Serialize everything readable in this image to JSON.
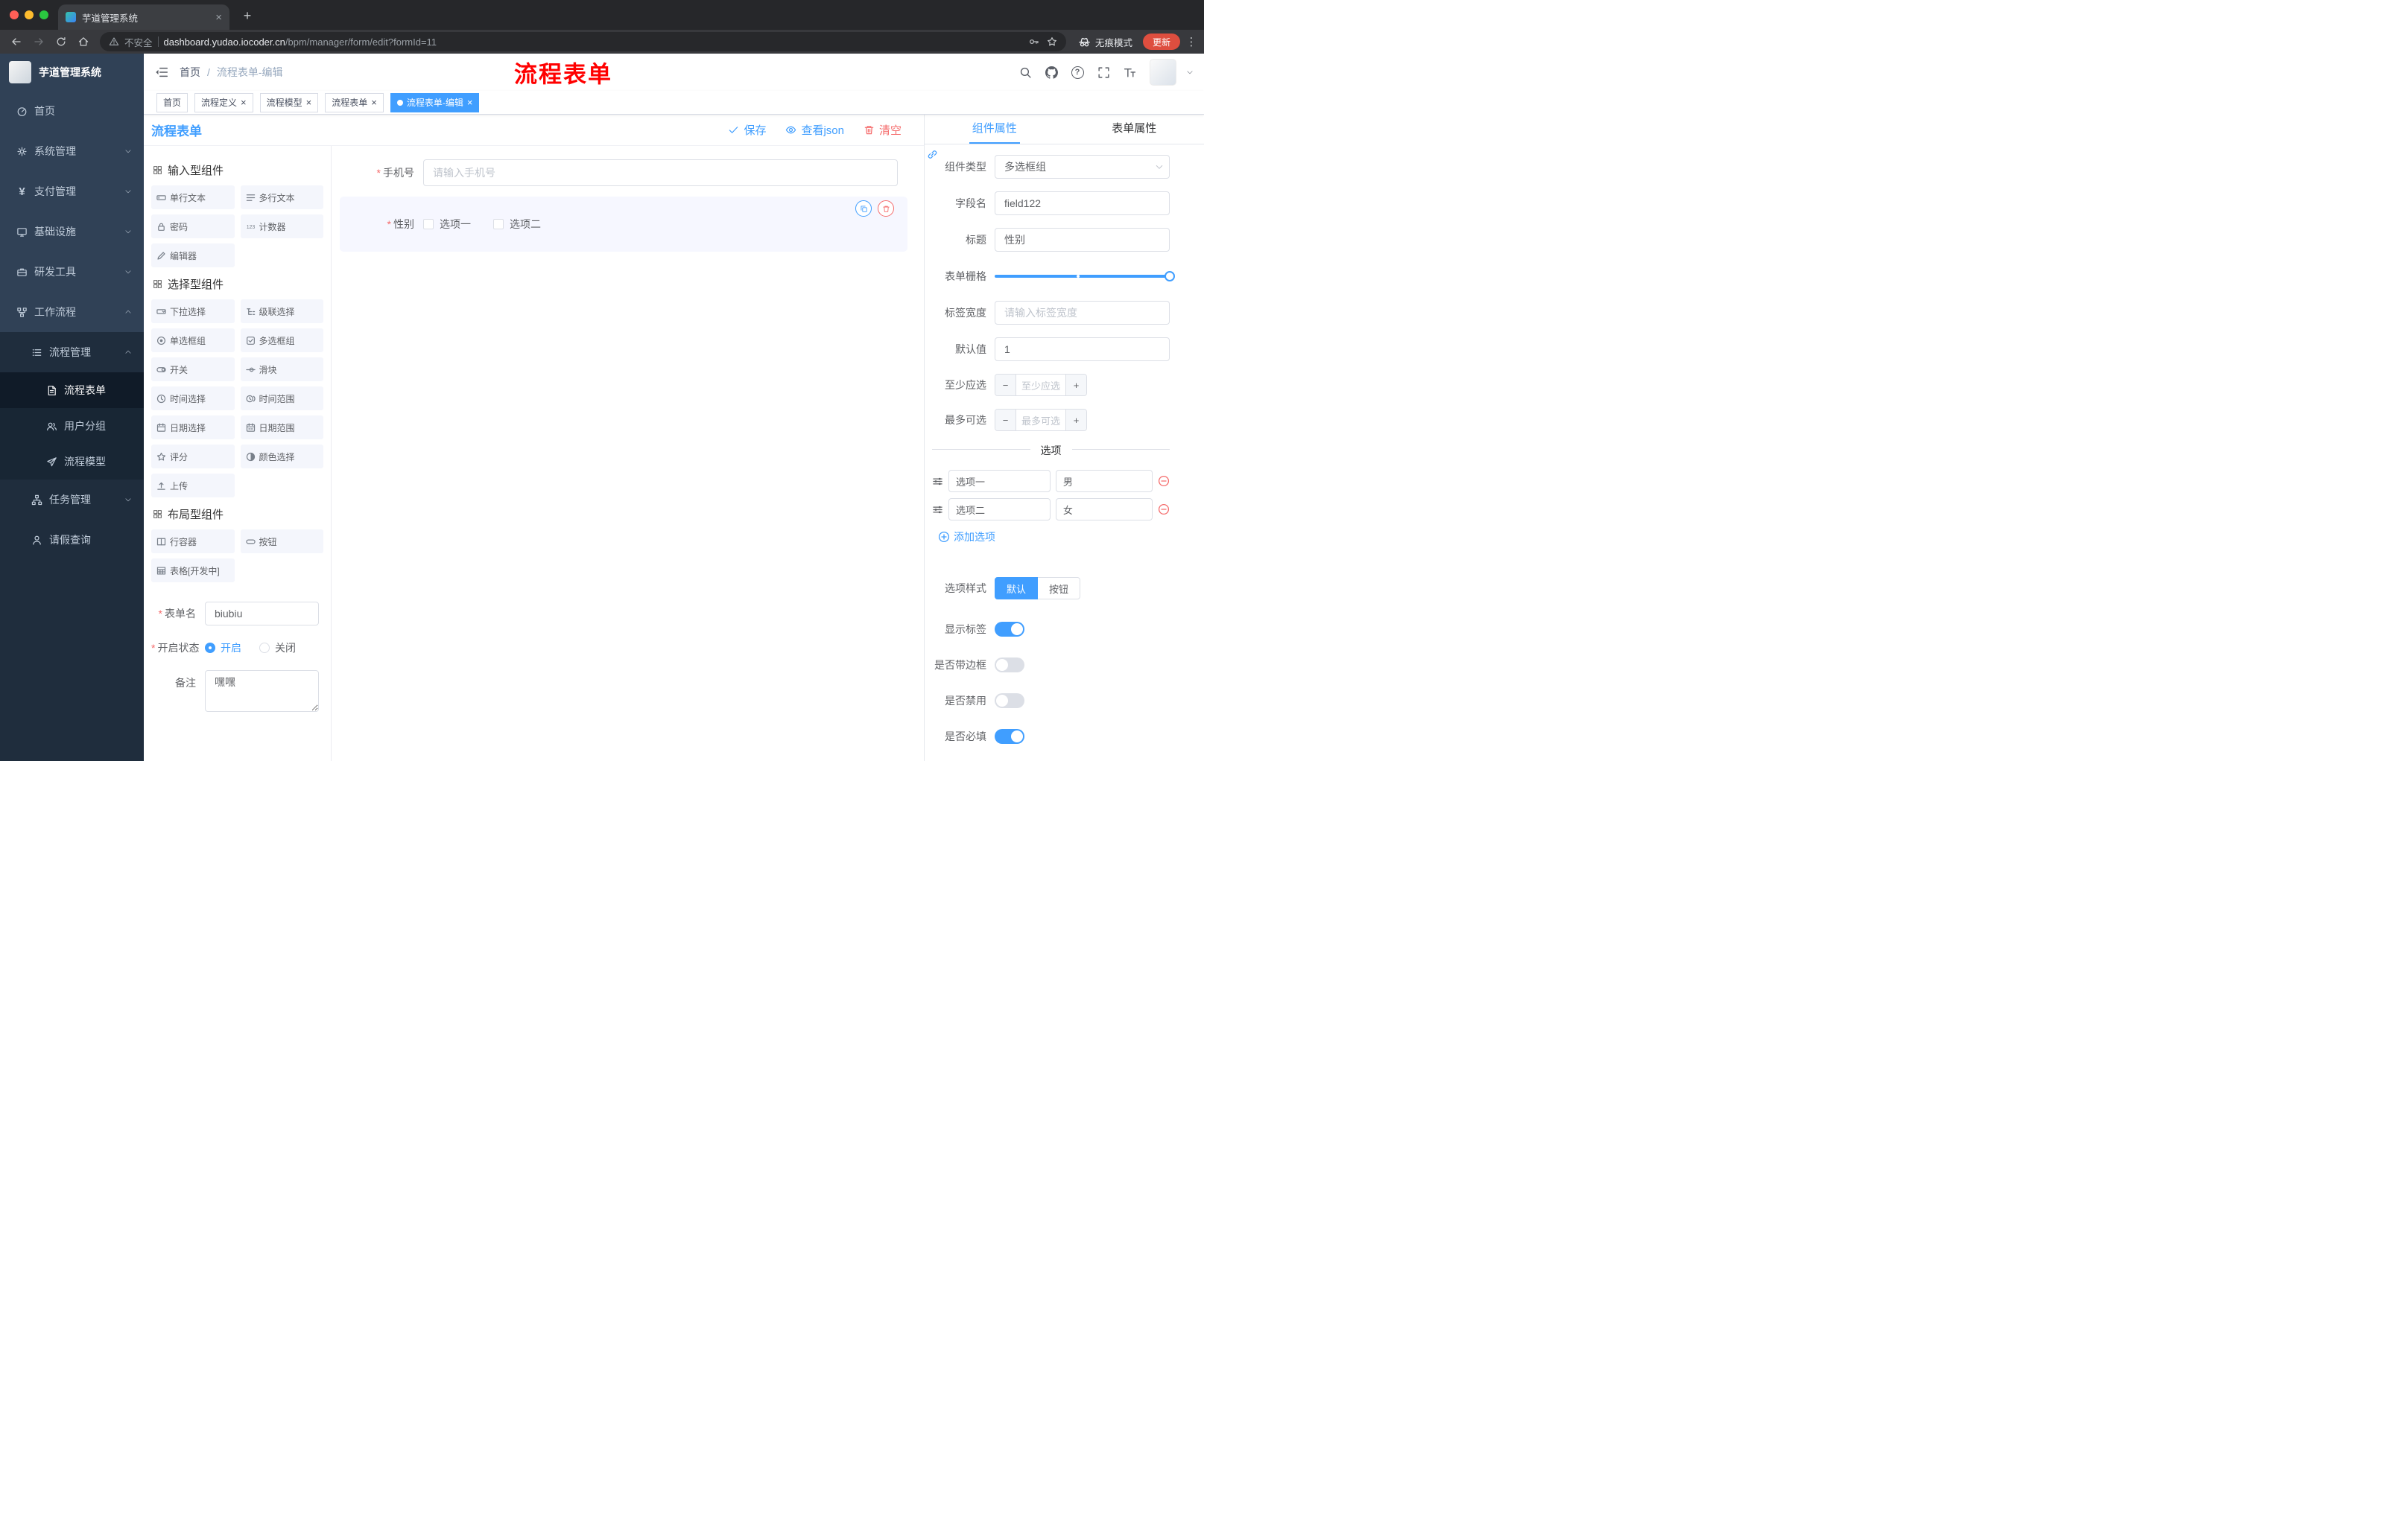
{
  "glyphs": {
    "star": "*",
    "close": "×",
    "plus": "+",
    "minus": "−",
    "dots": "⋮",
    "slash": "/",
    "question": "?"
  },
  "colors": {
    "accent": "#409eff",
    "danger": "#f56c6c",
    "annotation_red": "#ff0000",
    "sidebar_bg": "#304156",
    "sidebar_sub_bg": "#1f2d3d",
    "update_chip": "#de4e3f",
    "selected_item_bg": "#f6f7ff"
  },
  "browser": {
    "tab_title": "芋道管理系统",
    "security_label": "不安全",
    "url_host": "dashboard.yudao.iocoder.cn",
    "url_path": "/bpm/manager/form/edit?formId=11",
    "incognito_label": "无痕模式",
    "update_label": "更新"
  },
  "sidebar": {
    "logo_title": "芋道管理系统",
    "items": [
      {
        "label": "首页"
      },
      {
        "label": "系统管理"
      },
      {
        "label": "支付管理"
      },
      {
        "label": "基础设施"
      },
      {
        "label": "研发工具"
      },
      {
        "label": "工作流程"
      },
      {
        "label": "流程管理"
      },
      {
        "label": "流程表单"
      },
      {
        "label": "用户分组"
      },
      {
        "label": "流程模型"
      },
      {
        "label": "任务管理"
      },
      {
        "label": "请假查询"
      }
    ]
  },
  "header": {
    "breadcrumb_home": "首页",
    "breadcrumb_current": "流程表单-编辑",
    "annotation": "流程表单"
  },
  "tags": [
    {
      "label": "首页"
    },
    {
      "label": "流程定义"
    },
    {
      "label": "流程模型"
    },
    {
      "label": "流程表单"
    },
    {
      "label": "流程表单-编辑"
    }
  ],
  "designer": {
    "title": "流程表单",
    "save_label": "保存",
    "view_json_label": "查看json",
    "clear_label": "清空",
    "palette": {
      "group1_title": "输入型组件",
      "group1_items": [
        "单行文本",
        "多行文本",
        "密码",
        "计数器",
        "编辑器"
      ],
      "group2_title": "选择型组件",
      "group2_items": [
        "下拉选择",
        "级联选择",
        "单选框组",
        "多选框组",
        "开关",
        "滑块",
        "时间选择",
        "时间范围",
        "日期选择",
        "日期范围",
        "评分",
        "颜色选择",
        "上传"
      ],
      "group3_title": "布局型组件",
      "group3_items": [
        "行容器",
        "按钮",
        "表格[开发中]"
      ]
    },
    "meta_form": {
      "name_label": "表单名",
      "name_value": "biubiu",
      "status_label": "开启状态",
      "status_on": "开启",
      "status_off": "关闭",
      "remark_label": "备注",
      "remark_value": "嘿嘿"
    },
    "canvas": {
      "phone_label": "手机号",
      "phone_placeholder": "请输入手机号",
      "gender_label": "性别",
      "gender_option1": "选项一",
      "gender_option2": "选项二"
    },
    "props": {
      "tab_component": "组件属性",
      "tab_form": "表单属性",
      "type_label": "组件类型",
      "type_value": "多选框组",
      "field_label": "字段名",
      "field_value": "field122",
      "title_label": "标题",
      "title_value": "性别",
      "grid_label": "表单栅格",
      "width_label": "标签宽度",
      "width_placeholder": "请输入标签宽度",
      "default_label": "默认值",
      "default_value": "1",
      "min_label": "至少应选",
      "min_placeholder": "至少应选",
      "max_label": "最多可选",
      "max_placeholder": "最多可选",
      "options_title": "选项",
      "option1_label": "选项一",
      "option1_value": "男",
      "option2_label": "选项二",
      "option2_value": "女",
      "add_option": "添加选项",
      "style_label": "选项样式",
      "style_default": "默认",
      "style_button": "按钮",
      "show_label": "显示标签",
      "border_label": "是否带边框",
      "disabled_label": "是否禁用",
      "required_label": "是否必填"
    }
  }
}
